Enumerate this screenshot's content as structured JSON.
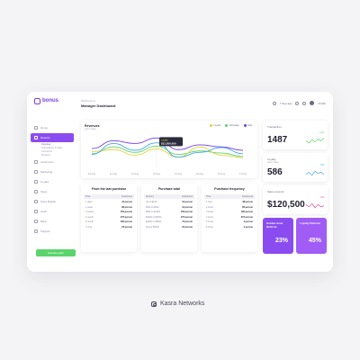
{
  "app": {
    "logo": "bonus"
  },
  "header": {
    "welcome": "Welcome to",
    "title": "Manager Dashboard",
    "range": "7 Sep ago",
    "profile": "Profile"
  },
  "sidebar": {
    "items": [
      {
        "label": "Home"
      },
      {
        "label": "Reports"
      },
      {
        "label": "Customers"
      },
      {
        "label": "Marketing"
      },
      {
        "label": "Loyalty"
      },
      {
        "label": "Store"
      },
      {
        "label": "Store Builder"
      },
      {
        "label": "Cash"
      },
      {
        "label": "Bank"
      },
      {
        "label": "Support"
      }
    ],
    "subitems": [
      "Overview",
      "Transactions & Sales",
      "Customers",
      "Products"
    ],
    "cta": "Activate plan!"
  },
  "revenue": {
    "title": "Revenues",
    "subtitle": "Last 7 days",
    "legend": [
      {
        "label": "Loyalty",
        "color": "#e3d43a"
      },
      {
        "label": "Campaign",
        "color": "#5bd46a"
      },
      {
        "label": "Total",
        "color": "#6f3fe6"
      }
    ],
    "tooltip_label": "Loyalty",
    "tooltip_value": "$12,500,000"
  },
  "chart_data": {
    "type": "line",
    "categories": [
      "10 Aug",
      "11 Aug",
      "12 Aug",
      "13 Aug",
      "14 Aug",
      "15 Aug",
      "16 Aug",
      "17 Aug"
    ],
    "series": [
      {
        "name": "Total",
        "color": "#6f3fe6",
        "values": [
          55,
          78,
          70,
          86,
          52,
          66,
          60,
          50
        ]
      },
      {
        "name": "Campaign",
        "color": "#5bd46a",
        "values": [
          40,
          60,
          44,
          62,
          38,
          48,
          42,
          32
        ]
      },
      {
        "name": "Loyalty",
        "color": "#e3d43a",
        "values": [
          46,
          52,
          36,
          54,
          30,
          60,
          36,
          28
        ]
      },
      {
        "name": "",
        "color": "#4aa8e8",
        "values": [
          38,
          70,
          50,
          72,
          30,
          44,
          58,
          40
        ]
      }
    ],
    "ylim": [
      0,
      100
    ]
  },
  "tables": [
    {
      "title": "From the last purchase",
      "head": [
        "Time",
        "Customers"
      ],
      "rows": [
        [
          "1 days",
          "10 person"
        ],
        [
          "1 week",
          "88 person"
        ],
        [
          "2 weeks",
          "150 person"
        ],
        [
          "1 month",
          "170 person"
        ],
        [
          "6 month",
          "180 person"
        ],
        [
          "1 Year",
          "22 person"
        ]
      ]
    },
    {
      "title": "Purchase total",
      "head": [
        "Amount",
        "Customers"
      ],
      "rows": [
        [
          "Up to $100",
          "10 person"
        ],
        [
          "$100 to $500",
          "12 person"
        ],
        [
          "$500 to $1000",
          "150 person"
        ],
        [
          "$1000 to $2000",
          "170 person"
        ],
        [
          "$2000 to $5000",
          "72 person"
        ],
        [
          "Above $5000",
          "22 person"
        ]
      ]
    },
    {
      "title": "Purchase frequency",
      "head": [
        "Time",
        "Customers"
      ],
      "rows": [
        [
          "1 time",
          "48 person"
        ],
        [
          "2 times",
          "80 person"
        ],
        [
          "3 times",
          "180 person"
        ],
        [
          "4 times",
          "207 person"
        ],
        [
          "5 times",
          "4 person"
        ],
        [
          "6 times",
          "1 person"
        ]
      ]
    }
  ],
  "stats": [
    {
      "label": "Transaction",
      "sub": "",
      "value": "1487",
      "badge": "+3%",
      "color": "#5bd46a"
    },
    {
      "label": "Loyalty",
      "sub": "Last 7 days",
      "value": "586",
      "badge": "8%",
      "color": "#4aa8e8"
    },
    {
      "label": "Sales amount",
      "sub": "",
      "value": "$120,500",
      "badge": "8%",
      "color": "#e24ba0"
    }
  ],
  "promos": [
    {
      "title": "Golden done Referral",
      "value": "23%",
      "color": "#8a4cf0"
    },
    {
      "title": "Loyalty Referral",
      "value": "45%",
      "color": "#a05cf5"
    }
  ],
  "credit": "Kasra Networks"
}
